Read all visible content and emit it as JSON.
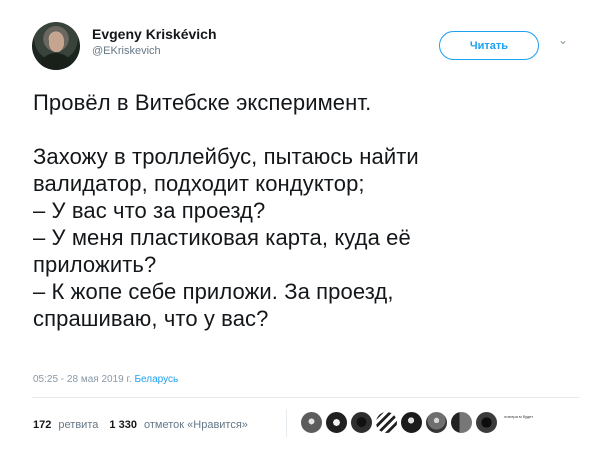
{
  "author": {
    "display_name": "Evgeny Kriskévich",
    "handle": "@EKriskevich"
  },
  "actions": {
    "follow_label": "Читать",
    "menu_icon": "chevron-down-icon"
  },
  "tweet": {
    "lines": [
      "Провёл в Витебске эксперимент.",
      "",
      "Захожу в троллейбус, пытаюсь найти",
      "валидатор, подходит кондуктор;",
      "– У вас что за проезд?",
      "– У меня пластиковая карта, куда её",
      "приложить?",
      "– К жопе себе приложи. За проезд,",
      "спрашиваю, что у вас?"
    ],
    "time": "05:25 - 28 мая 2019 г.",
    "location": "Беларусь"
  },
  "stats": {
    "retweets_count": "172",
    "retweets_label": "ретвита",
    "likes_count": "1 330",
    "likes_label": "отметок «Нравится»"
  },
  "likers": {
    "avatars_count": 8,
    "tiny_text": "лоютра\nм будет"
  },
  "colors": {
    "accent": "#1da1f2",
    "text": "#14171a",
    "muted": "#657786",
    "border": "#e6ecf0"
  }
}
